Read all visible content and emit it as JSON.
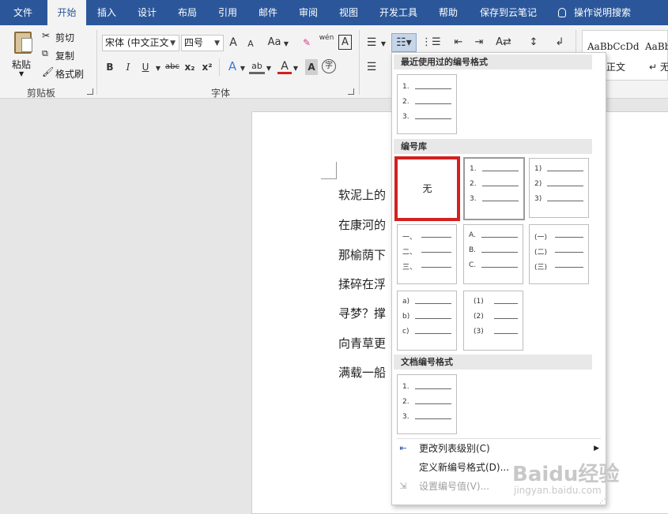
{
  "tabs": [
    "文件",
    "开始",
    "插入",
    "设计",
    "布局",
    "引用",
    "邮件",
    "审阅",
    "视图",
    "开发工具",
    "帮助",
    "保存到云笔记"
  ],
  "active_tab": "开始",
  "tell_me": "操作说明搜索",
  "clipboard": {
    "paste": "粘贴",
    "cut": "剪切",
    "copy": "复制",
    "format_painter": "格式刷",
    "label": "剪贴板"
  },
  "font": {
    "name": "宋体 (中文正文",
    "size": "四号",
    "label": "字体",
    "grow": "A",
    "shrink": "A",
    "case": "Aa",
    "phonetic": "wén",
    "bold": "B",
    "italic": "I",
    "underline": "U",
    "strike": "abc",
    "sub": "x₂",
    "sup": "x²",
    "effects": "A",
    "highlight": "ab",
    "color": "A",
    "shade": "A",
    "enclose": "字"
  },
  "styles": {
    "s1_preview": "AaBbCcDd",
    "s1_name": "正文",
    "s2_preview": "AaBb",
    "s2_name": "无"
  },
  "document": {
    "paragraphs": [
      "软泥上的",
      "在康河的",
      "那榆荫下",
      "揉碎在浮",
      "寻梦？撑",
      "向青草更",
      "满载一船"
    ]
  },
  "menu": {
    "recent_header": "最近使用过的编号格式",
    "library_header": "编号库",
    "doc_header": "文档编号格式",
    "none_label": "无",
    "fmt_arabic": [
      "1.",
      "2.",
      "3."
    ],
    "fmt_paren": [
      "1)",
      "2)",
      "3)"
    ],
    "fmt_chinese": [
      "一、",
      "二、",
      "三、"
    ],
    "fmt_upper": [
      "A.",
      "B.",
      "C."
    ],
    "fmt_chinese_paren": [
      "(一)",
      "(二)",
      "(三)"
    ],
    "fmt_lower": [
      "a)",
      "b)",
      "c)"
    ],
    "fmt_full_paren": [
      "(1)",
      "(2)",
      "(3)"
    ],
    "change_level": "更改列表级别(C)",
    "define_new": "定义新编号格式(D)...",
    "set_value": "设置编号值(V)..."
  },
  "watermark": {
    "main": "Baidu经验",
    "sub": "jingyan.baidu.com"
  },
  "colors": {
    "ribbon_blue": "#2b579a",
    "highlight_red": "#d32020"
  }
}
